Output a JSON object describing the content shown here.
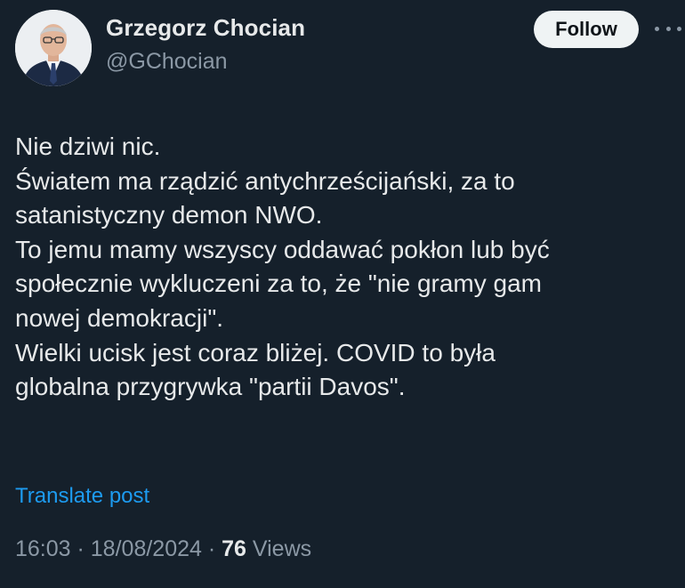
{
  "author": {
    "display_name": "Grzegorz Chocian",
    "handle": "@GChocian"
  },
  "follow_label": "Follow",
  "more_icon": "more-horizontal-icon",
  "tweet": {
    "lines": [
      "Nie dziwi nic.",
      "Światem ma rządzić antychrześcijański, za to",
      "satanistyczny demon NWO.",
      "To jemu mamy wszyscy oddawać pokłon lub być",
      "społecznie wykluczeni za to, że \"nie gramy gam",
      "nowej demokracji\".",
      "Wielki ucisk jest coraz bliżej. COVID to była",
      "globalna przygrywka \"partii Davos\"."
    ]
  },
  "translate_label": "Translate post",
  "meta": {
    "time": "16:03",
    "separator": " · ",
    "date": "18/08/2024",
    "views_count": "76",
    "views_label": "Views"
  },
  "colors": {
    "background": "#15202b",
    "text": "#e7e9ea",
    "secondary": "#8b98a5",
    "link": "#1d9bf0",
    "button_bg": "#eff3f4"
  }
}
